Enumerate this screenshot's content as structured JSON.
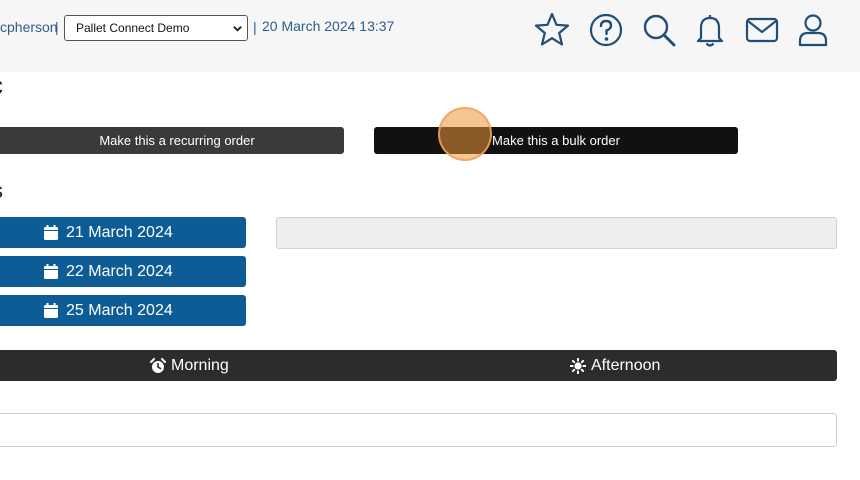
{
  "header": {
    "user_fragment": "cpherson",
    "separator": "|",
    "company_select_value": "Pallet Connect Demo",
    "datetime": "20 March 2024 13:37",
    "icons": [
      "star-icon",
      "help-icon",
      "search-icon",
      "bell-icon",
      "mail-icon",
      "user-icon"
    ],
    "icon_color": "#1f4e79"
  },
  "main": {
    "heading_fragment": "c",
    "section_fragment": "s",
    "recurring_button_label": "Make this a recurring order",
    "bulk_button_label": "Make this a bulk order",
    "dates": [
      {
        "label": "21 March 2024"
      },
      {
        "label": "22 March 2024"
      },
      {
        "label": "25 March 2024"
      }
    ],
    "time_slots": [
      {
        "label": "Morning",
        "icon": "alarm-clock-icon"
      },
      {
        "label": "Afternoon",
        "icon": "sun-icon"
      }
    ]
  },
  "colors": {
    "date_button": "#0d5c96",
    "dark_button": "#3a3a3a",
    "bulk_button": "#111111",
    "click_marker": "#ec963c"
  }
}
